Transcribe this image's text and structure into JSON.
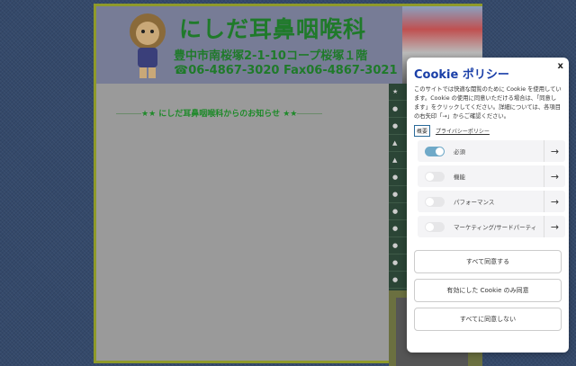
{
  "site": {
    "title": "にしだ耳鼻咽喉科",
    "address": "豊中市南桜塚2-1-10コープ桜塚１階",
    "tel": "☎06-4867-3020 Fax06-4867-3021",
    "notice": "★★ にしだ耳鼻咽喉科からのお知らせ ★★"
  },
  "cookie": {
    "title": "Cookie ポリシー",
    "close": "x",
    "description": "このサイトでは快適な閲覧のために Cookie を使用しています。Cookie の使用に同意いただける場合は、「同意します」をクリックしてください。詳細については、各項目の右矢印「→」からご確認ください。",
    "overview_link": "概要",
    "privacy_link": "プライバシーポリシー",
    "categories": [
      {
        "label": "必須",
        "enabled": true
      },
      {
        "label": "機能",
        "enabled": false
      },
      {
        "label": "パフォーマンス",
        "enabled": false
      },
      {
        "label": "マーケティング/サードパーティ",
        "enabled": false
      }
    ],
    "arrow": "→",
    "buttons": {
      "accept_all": "すべて同意する",
      "accept_selected": "有効にした Cookie のみ同意",
      "reject_all": "すべてに同意しない"
    }
  }
}
